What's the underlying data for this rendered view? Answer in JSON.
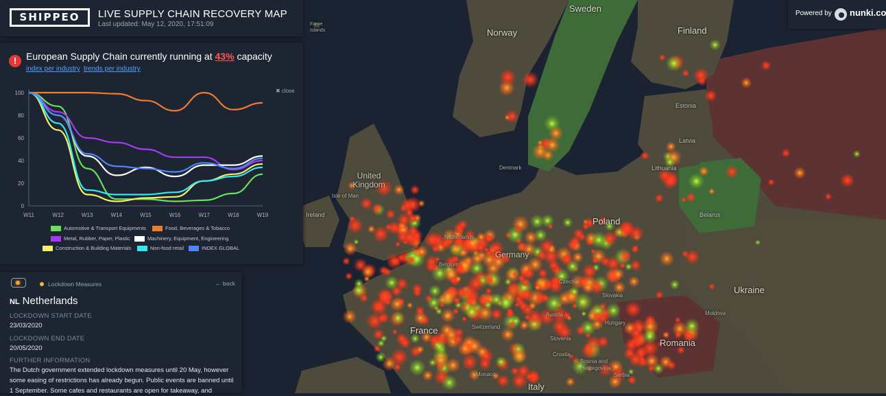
{
  "header": {
    "logo_text": "SHIPPEO",
    "title": "LIVE SUPPLY CHAIN RECOVERY MAP",
    "last_updated": "Last updated: May 12, 2020, 17:51:09"
  },
  "powered": {
    "label": "Powered by",
    "brand": "nunki.co"
  },
  "capacity": {
    "prefix": "European Supply Chain currently running at",
    "percent": "43%",
    "suffix": "capacity",
    "link_industry": "index per industry",
    "link_trends": "trends per industry",
    "close_label": "close",
    "alert_icon": "exclamation-icon"
  },
  "chart_data": {
    "type": "line",
    "title": "",
    "xlabel": "",
    "ylabel": "",
    "x": [
      "W11",
      "W12",
      "W13",
      "W14",
      "W15",
      "W16",
      "W17",
      "W18",
      "W19"
    ],
    "yticks": [
      "0",
      "20",
      "40",
      "60",
      "80",
      "100"
    ],
    "ylim": [
      0,
      100
    ],
    "grid": false,
    "legend_position": "bottom",
    "series": [
      {
        "name": "Automotive & Transport Equipments",
        "color": "#6be05a",
        "values": [
          100,
          88,
          33,
          6,
          6,
          4,
          5,
          11,
          28
        ]
      },
      {
        "name": "Food, Beverages & Tobacco",
        "color": "#f07c2f",
        "values": [
          100,
          100,
          100,
          99,
          93,
          84,
          100,
          85,
          91
        ]
      },
      {
        "name": "Metal, Rubber, Paper, Plastic",
        "color": "#a53cf0",
        "values": [
          100,
          83,
          60,
          56,
          50,
          43,
          43,
          32,
          40
        ]
      },
      {
        "name": "Machinery, Equipment, Engineering",
        "color": "#ffffff",
        "values": [
          100,
          80,
          44,
          27,
          34,
          26,
          36,
          36,
          44
        ]
      },
      {
        "name": "Construction & Building Materials",
        "color": "#f7f06a",
        "values": [
          100,
          67,
          10,
          4,
          7,
          8,
          22,
          28,
          37
        ]
      },
      {
        "name": "Non-food retail",
        "color": "#38e6f0",
        "values": [
          100,
          73,
          14,
          10,
          10,
          12,
          22,
          26,
          34
        ]
      },
      {
        "name": "INDEX GLOBAL",
        "color": "#4f86f7",
        "values": [
          100,
          80,
          46,
          35,
          33,
          30,
          38,
          33,
          42
        ]
      }
    ]
  },
  "lockdown": {
    "toggle_icon": "toggle-icon",
    "label": "Lockdown Measures",
    "back_label": "back",
    "country_code": "NL",
    "country": "Netherlands",
    "start_label": "LOCKDOWN START DATE",
    "start_value": "23/03/2020",
    "end_label": "LOCKDOWN END DATE",
    "end_value": "20/05/2020",
    "info_label": "FURTHER INFORMATION",
    "info_text": "The Dutch government extended lockdown measures until 20 May, however some easing of restrictions has already begun. Public events are banned until 1 September. Some cafes and restaurants are open for takeaway, and"
  },
  "map": {
    "colors": {
      "sea": "#1b2332",
      "land": "#4e4a3c",
      "green_country": "#3f6b39",
      "red_country": "#5c3232"
    },
    "labels": [
      "Sweden",
      "Norway",
      "Finland",
      "Estonia",
      "Latvia",
      "Lithuania",
      "Denmark",
      "United Kingdom",
      "Isle of Man",
      "Ireland",
      "Netherlands",
      "Belgium",
      "Germany",
      "Poland",
      "Belarus",
      "Czechia",
      "Slovakia",
      "Austria",
      "Switzerland",
      "France",
      "Hungary",
      "Moldova",
      "Ukraine",
      "Slovenia",
      "Croatia",
      "Bosnia and Herzegovina",
      "Romania",
      "Serbia",
      "Monaco",
      "Italy",
      "Faroe Islands"
    ]
  }
}
